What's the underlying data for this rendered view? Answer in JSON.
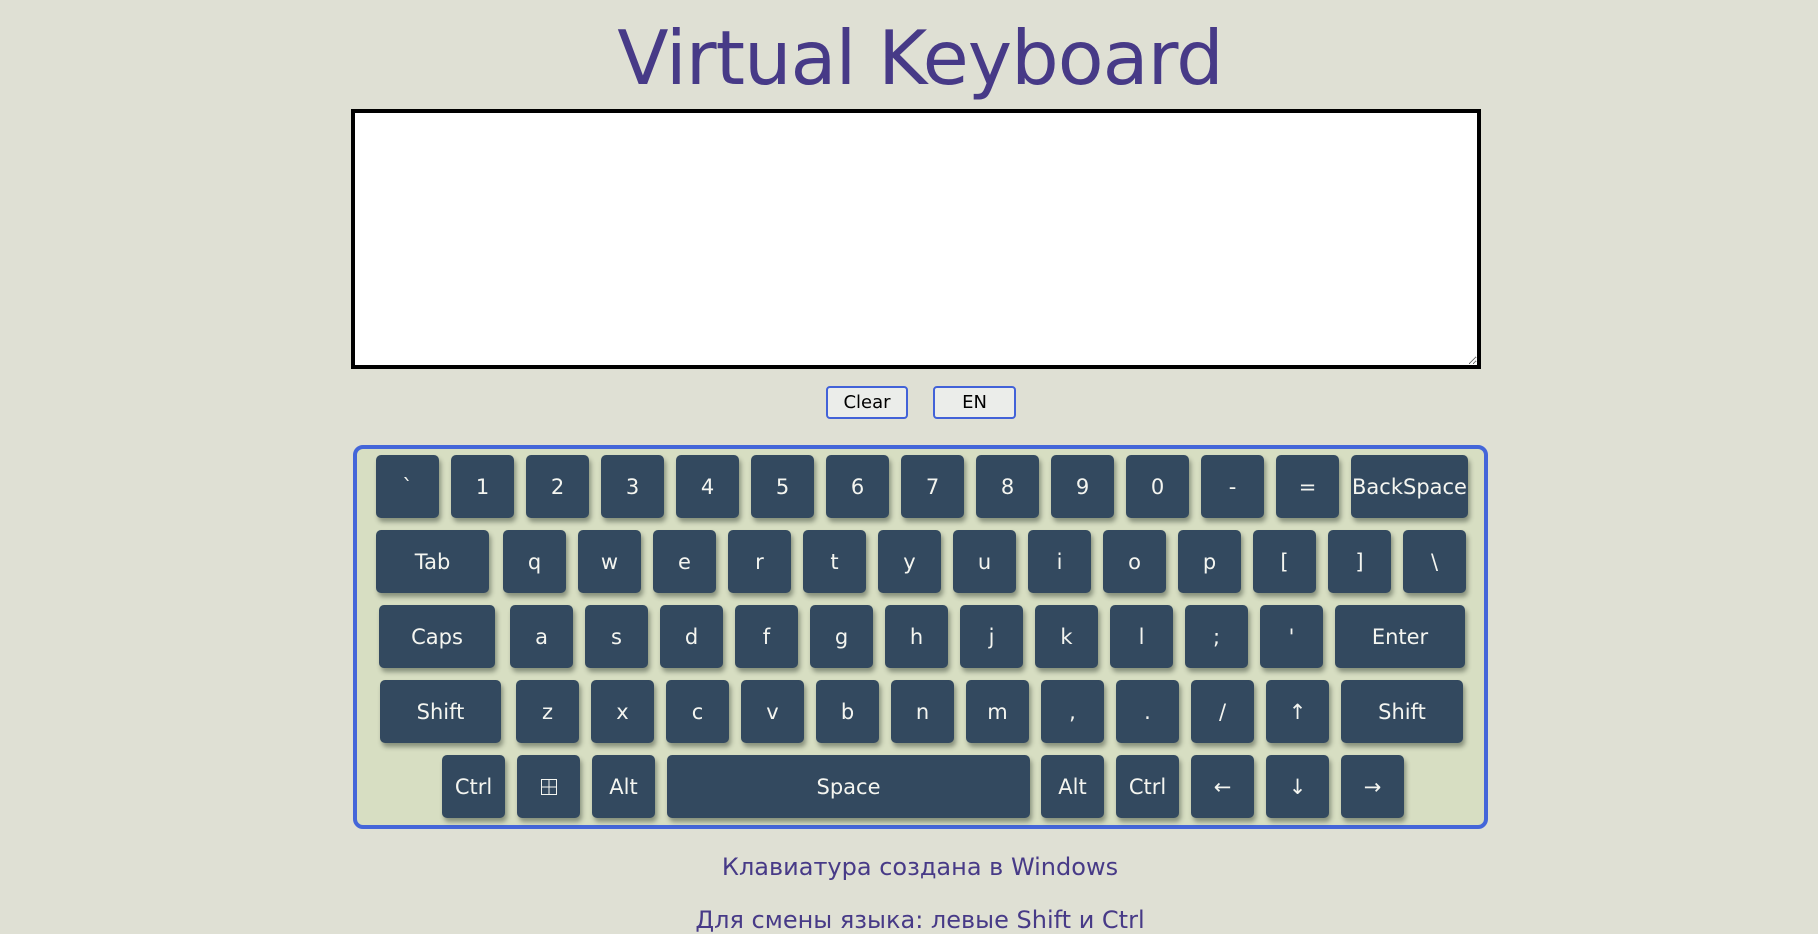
{
  "page": {
    "title": "Virtual Keyboard"
  },
  "textarea": {
    "value": ""
  },
  "controls": {
    "clear_label": "Clear",
    "lang_label": "EN"
  },
  "keyboard": {
    "rows": [
      [
        {
          "label": "`",
          "name": "key-backtick"
        },
        {
          "label": "1",
          "name": "key-1"
        },
        {
          "label": "2",
          "name": "key-2"
        },
        {
          "label": "3",
          "name": "key-3"
        },
        {
          "label": "4",
          "name": "key-4"
        },
        {
          "label": "5",
          "name": "key-5"
        },
        {
          "label": "6",
          "name": "key-6"
        },
        {
          "label": "7",
          "name": "key-7"
        },
        {
          "label": "8",
          "name": "key-8"
        },
        {
          "label": "9",
          "name": "key-9"
        },
        {
          "label": "0",
          "name": "key-0"
        },
        {
          "label": "-",
          "name": "key-minus"
        },
        {
          "label": "=",
          "name": "key-equal"
        },
        {
          "label": "BackSpace",
          "name": "key-backspace"
        }
      ],
      [
        {
          "label": "Tab",
          "name": "key-tab"
        },
        {
          "label": "q",
          "name": "key-q"
        },
        {
          "label": "w",
          "name": "key-w"
        },
        {
          "label": "e",
          "name": "key-e"
        },
        {
          "label": "r",
          "name": "key-r"
        },
        {
          "label": "t",
          "name": "key-t"
        },
        {
          "label": "y",
          "name": "key-y"
        },
        {
          "label": "u",
          "name": "key-u"
        },
        {
          "label": "i",
          "name": "key-i"
        },
        {
          "label": "o",
          "name": "key-o"
        },
        {
          "label": "p",
          "name": "key-p"
        },
        {
          "label": "[",
          "name": "key-bracket-left"
        },
        {
          "label": "]",
          "name": "key-bracket-right"
        },
        {
          "label": "\\",
          "name": "key-backslash"
        }
      ],
      [
        {
          "label": "Caps",
          "name": "key-caps"
        },
        {
          "label": "a",
          "name": "key-a"
        },
        {
          "label": "s",
          "name": "key-s"
        },
        {
          "label": "d",
          "name": "key-d"
        },
        {
          "label": "f",
          "name": "key-f"
        },
        {
          "label": "g",
          "name": "key-g"
        },
        {
          "label": "h",
          "name": "key-h"
        },
        {
          "label": "j",
          "name": "key-j"
        },
        {
          "label": "k",
          "name": "key-k"
        },
        {
          "label": "l",
          "name": "key-l"
        },
        {
          "label": ";",
          "name": "key-semicolon"
        },
        {
          "label": "'",
          "name": "key-quote"
        },
        {
          "label": "Enter",
          "name": "key-enter"
        }
      ],
      [
        {
          "label": "Shift",
          "name": "key-shift-left"
        },
        {
          "label": "z",
          "name": "key-z"
        },
        {
          "label": "x",
          "name": "key-x"
        },
        {
          "label": "c",
          "name": "key-c"
        },
        {
          "label": "v",
          "name": "key-v"
        },
        {
          "label": "b",
          "name": "key-b"
        },
        {
          "label": "n",
          "name": "key-n"
        },
        {
          "label": "m",
          "name": "key-m"
        },
        {
          "label": ",",
          "name": "key-comma"
        },
        {
          "label": ".",
          "name": "key-period"
        },
        {
          "label": "/",
          "name": "key-slash"
        },
        {
          "label": "↑",
          "name": "key-arrow-up"
        },
        {
          "label": "Shift",
          "name": "key-shift-right"
        }
      ],
      [
        {
          "label": "Ctrl",
          "name": "key-ctrl-left"
        },
        {
          "label": "",
          "name": "key-win",
          "icon": "windows-icon"
        },
        {
          "label": "Alt",
          "name": "key-alt-left"
        },
        {
          "label": "Space",
          "name": "key-space"
        },
        {
          "label": "Alt",
          "name": "key-alt-right"
        },
        {
          "label": "Ctrl",
          "name": "key-ctrl-right"
        },
        {
          "label": "←",
          "name": "key-arrow-left"
        },
        {
          "label": "↓",
          "name": "key-arrow-down"
        },
        {
          "label": "→",
          "name": "key-arrow-right"
        }
      ]
    ]
  },
  "footer": {
    "line1": "Клавиатура создана в Windows",
    "line2": "Для смены языка: левые Shift и Ctrl"
  },
  "colors": {
    "background": "#dfe0d4",
    "title": "#473a87",
    "key": "#33495f",
    "keyboard_bg": "#d7dec2",
    "keyboard_border": "#4466d9"
  }
}
